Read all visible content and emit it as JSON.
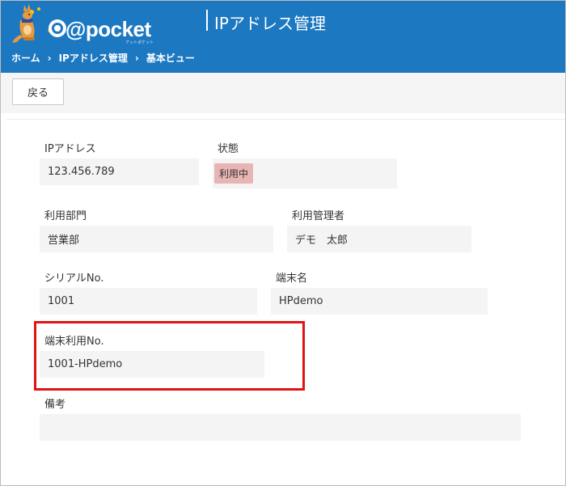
{
  "header": {
    "logo_text": "@pocket",
    "logo_sub": "アットポケット",
    "title": "IPアドレス管理"
  },
  "breadcrumb": {
    "home": "ホーム",
    "section": "IPアドレス管理",
    "current": "基本ビュー",
    "separator": "›"
  },
  "toolbar": {
    "back_label": "戻る"
  },
  "fields": {
    "ip_address": {
      "label": "IPアドレス",
      "value": "123.456.789"
    },
    "status": {
      "label": "状態",
      "value": "利用中"
    },
    "department": {
      "label": "利用部門",
      "value": "営業部"
    },
    "manager": {
      "label": "利用管理者",
      "value": "デモ　太郎"
    },
    "serial": {
      "label": "シリアルNo.",
      "value": "1001"
    },
    "terminal_name": {
      "label": "端末名",
      "value": "HPdemo"
    },
    "terminal_use_no": {
      "label": "端末利用No.",
      "value": "1001-HPdemo"
    },
    "remarks": {
      "label": "備考",
      "value": ""
    }
  },
  "colors": {
    "header_bg": "#1c78c0",
    "status_badge": "#e8b4b4",
    "highlight": "#e01414"
  }
}
